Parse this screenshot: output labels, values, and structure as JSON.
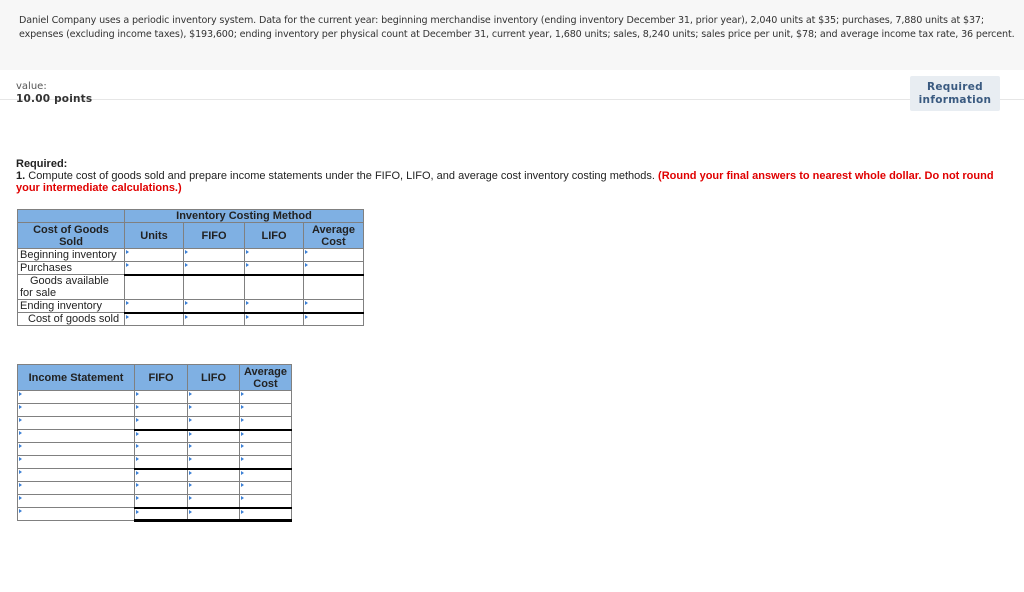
{
  "problem": {
    "text": "Daniel Company uses a periodic inventory system. Data for the current year: beginning merchandise inventory (ending inventory December 31, prior year), 2,040 units at $35; purchases, 7,880 units at $37; expenses (excluding income taxes), $193,600; ending inventory per physical count at December 31, current year, 1,680 units; sales, 8,240 units; sales price per unit, $78; and average income tax rate, 36 percent."
  },
  "meta": {
    "value_label": "value:",
    "points": "10.00 points"
  },
  "required_info_button": {
    "line1": "Required",
    "line2": "information"
  },
  "required": {
    "title": "Required:",
    "number": "1.",
    "text": " Compute cost of goods sold and prepare income statements under the FIFO, LIFO, and average cost inventory costing methods. ",
    "note": "(Round your final answers to nearest whole dollar. Do not round your intermediate calculations.)"
  },
  "cogs_table": {
    "group_header": "Inventory Costing Method",
    "corner_header": "Cost of Goods Sold",
    "columns": [
      "Units",
      "FIFO",
      "LIFO",
      "Average Cost"
    ],
    "rows": [
      {
        "label": "Beginning inventory",
        "values": [
          "",
          "",
          "",
          ""
        ]
      },
      {
        "label": "Purchases",
        "values": [
          "",
          "",
          "",
          ""
        ]
      },
      {
        "label": "Goods available for sale",
        "values": [
          "",
          "",
          "",
          ""
        ]
      },
      {
        "label": "Ending inventory",
        "values": [
          "",
          "",
          "",
          ""
        ]
      },
      {
        "label": "Cost of goods sold",
        "values": [
          "",
          "",
          "",
          ""
        ]
      }
    ]
  },
  "income_table": {
    "columns": [
      "Income Statement",
      "FIFO",
      "LIFO",
      "Average Cost"
    ],
    "rows": [
      {
        "label": "",
        "values": [
          "",
          "",
          ""
        ]
      },
      {
        "label": "",
        "values": [
          "",
          "",
          ""
        ]
      },
      {
        "label": "",
        "values": [
          "",
          "",
          ""
        ]
      },
      {
        "label": "",
        "values": [
          "",
          "",
          ""
        ]
      },
      {
        "label": "",
        "values": [
          "",
          "",
          ""
        ]
      },
      {
        "label": "",
        "values": [
          "",
          "",
          ""
        ]
      },
      {
        "label": "",
        "values": [
          "",
          "",
          ""
        ]
      },
      {
        "label": "",
        "values": [
          "",
          "",
          ""
        ]
      },
      {
        "label": "",
        "values": [
          "",
          "",
          ""
        ]
      },
      {
        "label": "",
        "values": [
          "",
          "",
          ""
        ]
      }
    ]
  }
}
